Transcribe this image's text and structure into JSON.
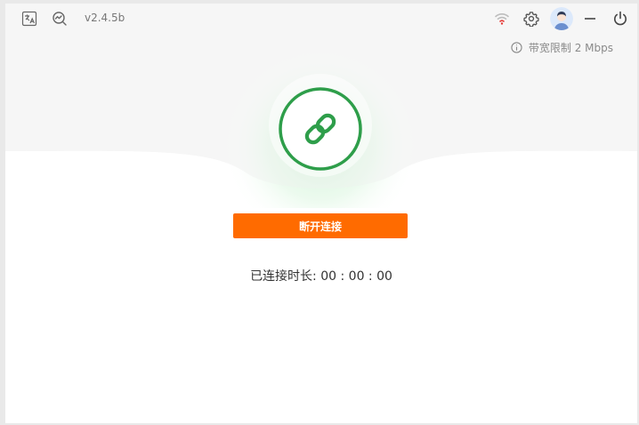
{
  "app": {
    "version": "v2.4.5b"
  },
  "titlebar": {
    "icons": [
      "translate-icon",
      "speed-test-icon",
      "wifi-signal-icon",
      "gear-icon",
      "avatar",
      "minimize-icon",
      "power-icon"
    ],
    "wifi_color": "#e53935"
  },
  "bandwidth": {
    "label": "带宽限制 2 Mbps"
  },
  "status": {
    "icon": "link-icon",
    "color": "#2e9e4a"
  },
  "actions": {
    "disconnect_label": "断开连接",
    "accent_color": "#ff6b00"
  },
  "connection": {
    "duration_label": "已连接时长:",
    "duration_value": "00 : 00 : 00"
  }
}
